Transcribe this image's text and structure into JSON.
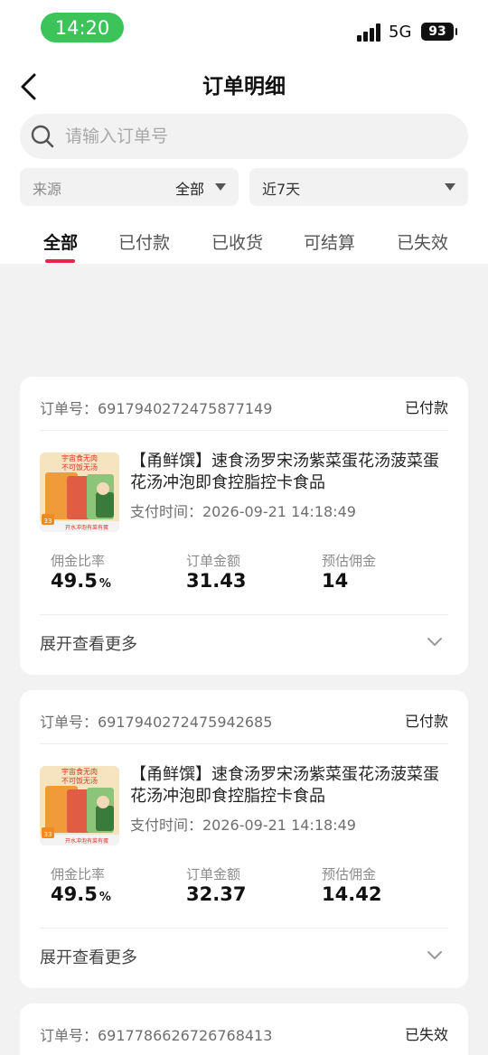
{
  "status_bar": {
    "time": "14:20",
    "network": "5G",
    "battery": "93"
  },
  "header": {
    "title": "订单明细"
  },
  "search": {
    "placeholder": "请输入订单号"
  },
  "filters": {
    "source_label": "来源",
    "source_value": "全部",
    "date_value": "近7天"
  },
  "tabs": [
    {
      "label": "全部",
      "active": true
    },
    {
      "label": "已付款"
    },
    {
      "label": "已收货"
    },
    {
      "label": "可结算"
    },
    {
      "label": "已失效"
    }
  ],
  "orders": [
    {
      "order_no": "订单号：6917940272475877149",
      "status": "已付款",
      "product_name": "【甬鲜馔】速食汤罗宋汤紫菜蛋花汤菠菜蛋花汤冲泡即食控脂控卡食品",
      "pay_time": "支付时间：2026-09-21 14:18:49",
      "commission_rate_label": "佣金比率",
      "commission_rate": "49.5",
      "rate_unit": "%",
      "amount_label": "订单金额",
      "amount": "31.43",
      "est_label": "预估佣金",
      "est_commission": "14",
      "expand": "展开查看更多"
    },
    {
      "order_no": "订单号：6917940272475942685",
      "status": "已付款",
      "product_name": "【甬鲜馔】速食汤罗宋汤紫菜蛋花汤菠菜蛋花汤冲泡即食控脂控卡食品",
      "pay_time": "支付时间：2026-09-21 14:18:49",
      "commission_rate_label": "佣金比率",
      "commission_rate": "49.5",
      "rate_unit": "%",
      "amount_label": "订单金额",
      "amount": "32.37",
      "est_label": "预估佣金",
      "est_commission": "14.42",
      "expand": "展开查看更多"
    },
    {
      "order_no": "订单号：6917786626726768413",
      "status": "已失效"
    }
  ],
  "thumb_text": {
    "line1": "宇宙食无肉",
    "line2": "不可饭无汤",
    "badge": "33",
    "footer": "开水冲泡有菜有蛋"
  },
  "colors": {
    "accent": "#e8244a",
    "time_pill": "#3cc35a"
  }
}
